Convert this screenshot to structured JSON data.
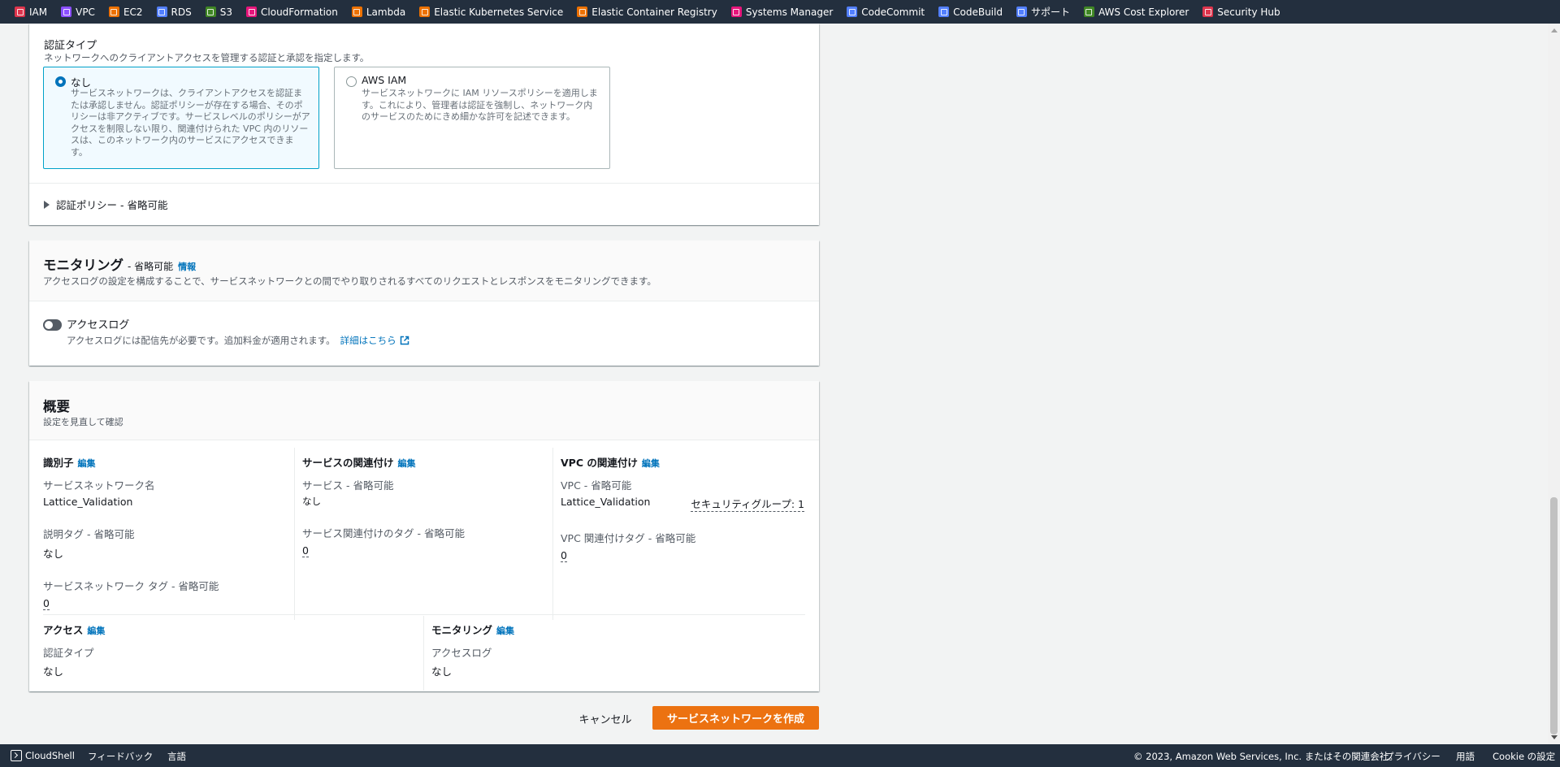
{
  "favorites": [
    {
      "label": "IAM",
      "color": "#dd344c"
    },
    {
      "label": "VPC",
      "color": "#8c4fff"
    },
    {
      "label": "EC2",
      "color": "#ed7100"
    },
    {
      "label": "RDS",
      "color": "#527fff"
    },
    {
      "label": "S3",
      "color": "#3f8624"
    },
    {
      "label": "CloudFormation",
      "color": "#e7157b"
    },
    {
      "label": "Lambda",
      "color": "#ed7100"
    },
    {
      "label": "Elastic Kubernetes Service",
      "color": "#ed7100"
    },
    {
      "label": "Elastic Container Registry",
      "color": "#ed7100"
    },
    {
      "label": "Systems Manager",
      "color": "#e7157b"
    },
    {
      "label": "CodeCommit",
      "color": "#527fff"
    },
    {
      "label": "CodeBuild",
      "color": "#527fff"
    },
    {
      "label": "サポート",
      "color": "#527fff"
    },
    {
      "label": "AWS Cost Explorer",
      "color": "#3f8624"
    },
    {
      "label": "Security Hub",
      "color": "#dd344c"
    }
  ],
  "auth": {
    "label": "認証タイプ",
    "description": "ネットワークへのクライアントアクセスを管理する認証と承認を指定します。",
    "options": [
      {
        "title": "なし",
        "description": "サービスネットワークは、クライアントアクセスを認証または承認しません。認証ポリシーが存在する場合、そのポリシーは非アクティブです。サービスレベルのポリシーがアクセスを制限しない限り、関連付けられた VPC 内のリソースは、このネットワーク内のサービスにアクセスできます。",
        "selected": true
      },
      {
        "title": "AWS IAM",
        "description": "サービスネットワークに IAM リソースポリシーを適用します。これにより、管理者は認証を強制し、ネットワーク内のサービスのためにきめ細かな許可を記述できます。",
        "selected": false
      }
    ],
    "policy_expander": "認証ポリシー - 省略可能"
  },
  "monitoring": {
    "title": "モニタリング",
    "optional": "- 省略可能",
    "info": "情報",
    "description": "アクセスログの設定を構成することで、サービスネットワークとの間でやり取りされるすべてのリクエストとレスポンスをモニタリングできます。",
    "toggle_label": "アクセスログ",
    "toggle_on": false,
    "toggle_desc": "アクセスログには配信先が必要です。追加料金が適用されます。",
    "learn_more": "詳細はこちら"
  },
  "summary": {
    "title": "概要",
    "description": "設定を見直して確認",
    "edit": "編集",
    "identifier": {
      "title": "識別子",
      "name_label": "サービスネットワーク名",
      "name_value": "Lattice_Validation",
      "desc_tag_label": "説明タグ - 省略可能",
      "desc_tag_value": "なし",
      "sn_tags_label": "サービスネットワーク タグ - 省略可能",
      "sn_tags_value": "0"
    },
    "service_assoc": {
      "title": "サービスの関連付け",
      "service_label": "サービス - 省略可能",
      "service_value": "なし",
      "tags_label": "サービス関連付けのタグ - 省略可能",
      "tags_value": "0"
    },
    "vpc_assoc": {
      "title": "VPC の関連付け",
      "vpc_label": "VPC - 省略可能",
      "vpc_value": "Lattice_Validation",
      "sg_value": "セキュリティグループ: 1",
      "tags_label": "VPC 関連付けタグ - 省略可能",
      "tags_value": "0"
    },
    "access": {
      "title": "アクセス",
      "auth_label": "認証タイプ",
      "auth_value": "なし"
    },
    "monitoring": {
      "title": "モニタリング",
      "log_label": "アクセスログ",
      "log_value": "なし"
    }
  },
  "actions": {
    "cancel": "キャンセル",
    "create": "サービスネットワークを作成"
  },
  "footer": {
    "cloudshell": "CloudShell",
    "feedback": "フィードバック",
    "language": "言語",
    "copyright": "© 2023, Amazon Web Services, Inc. またはその関連会社。",
    "privacy": "プライバシー",
    "terms": "用語",
    "cookie": "Cookie の設定"
  }
}
